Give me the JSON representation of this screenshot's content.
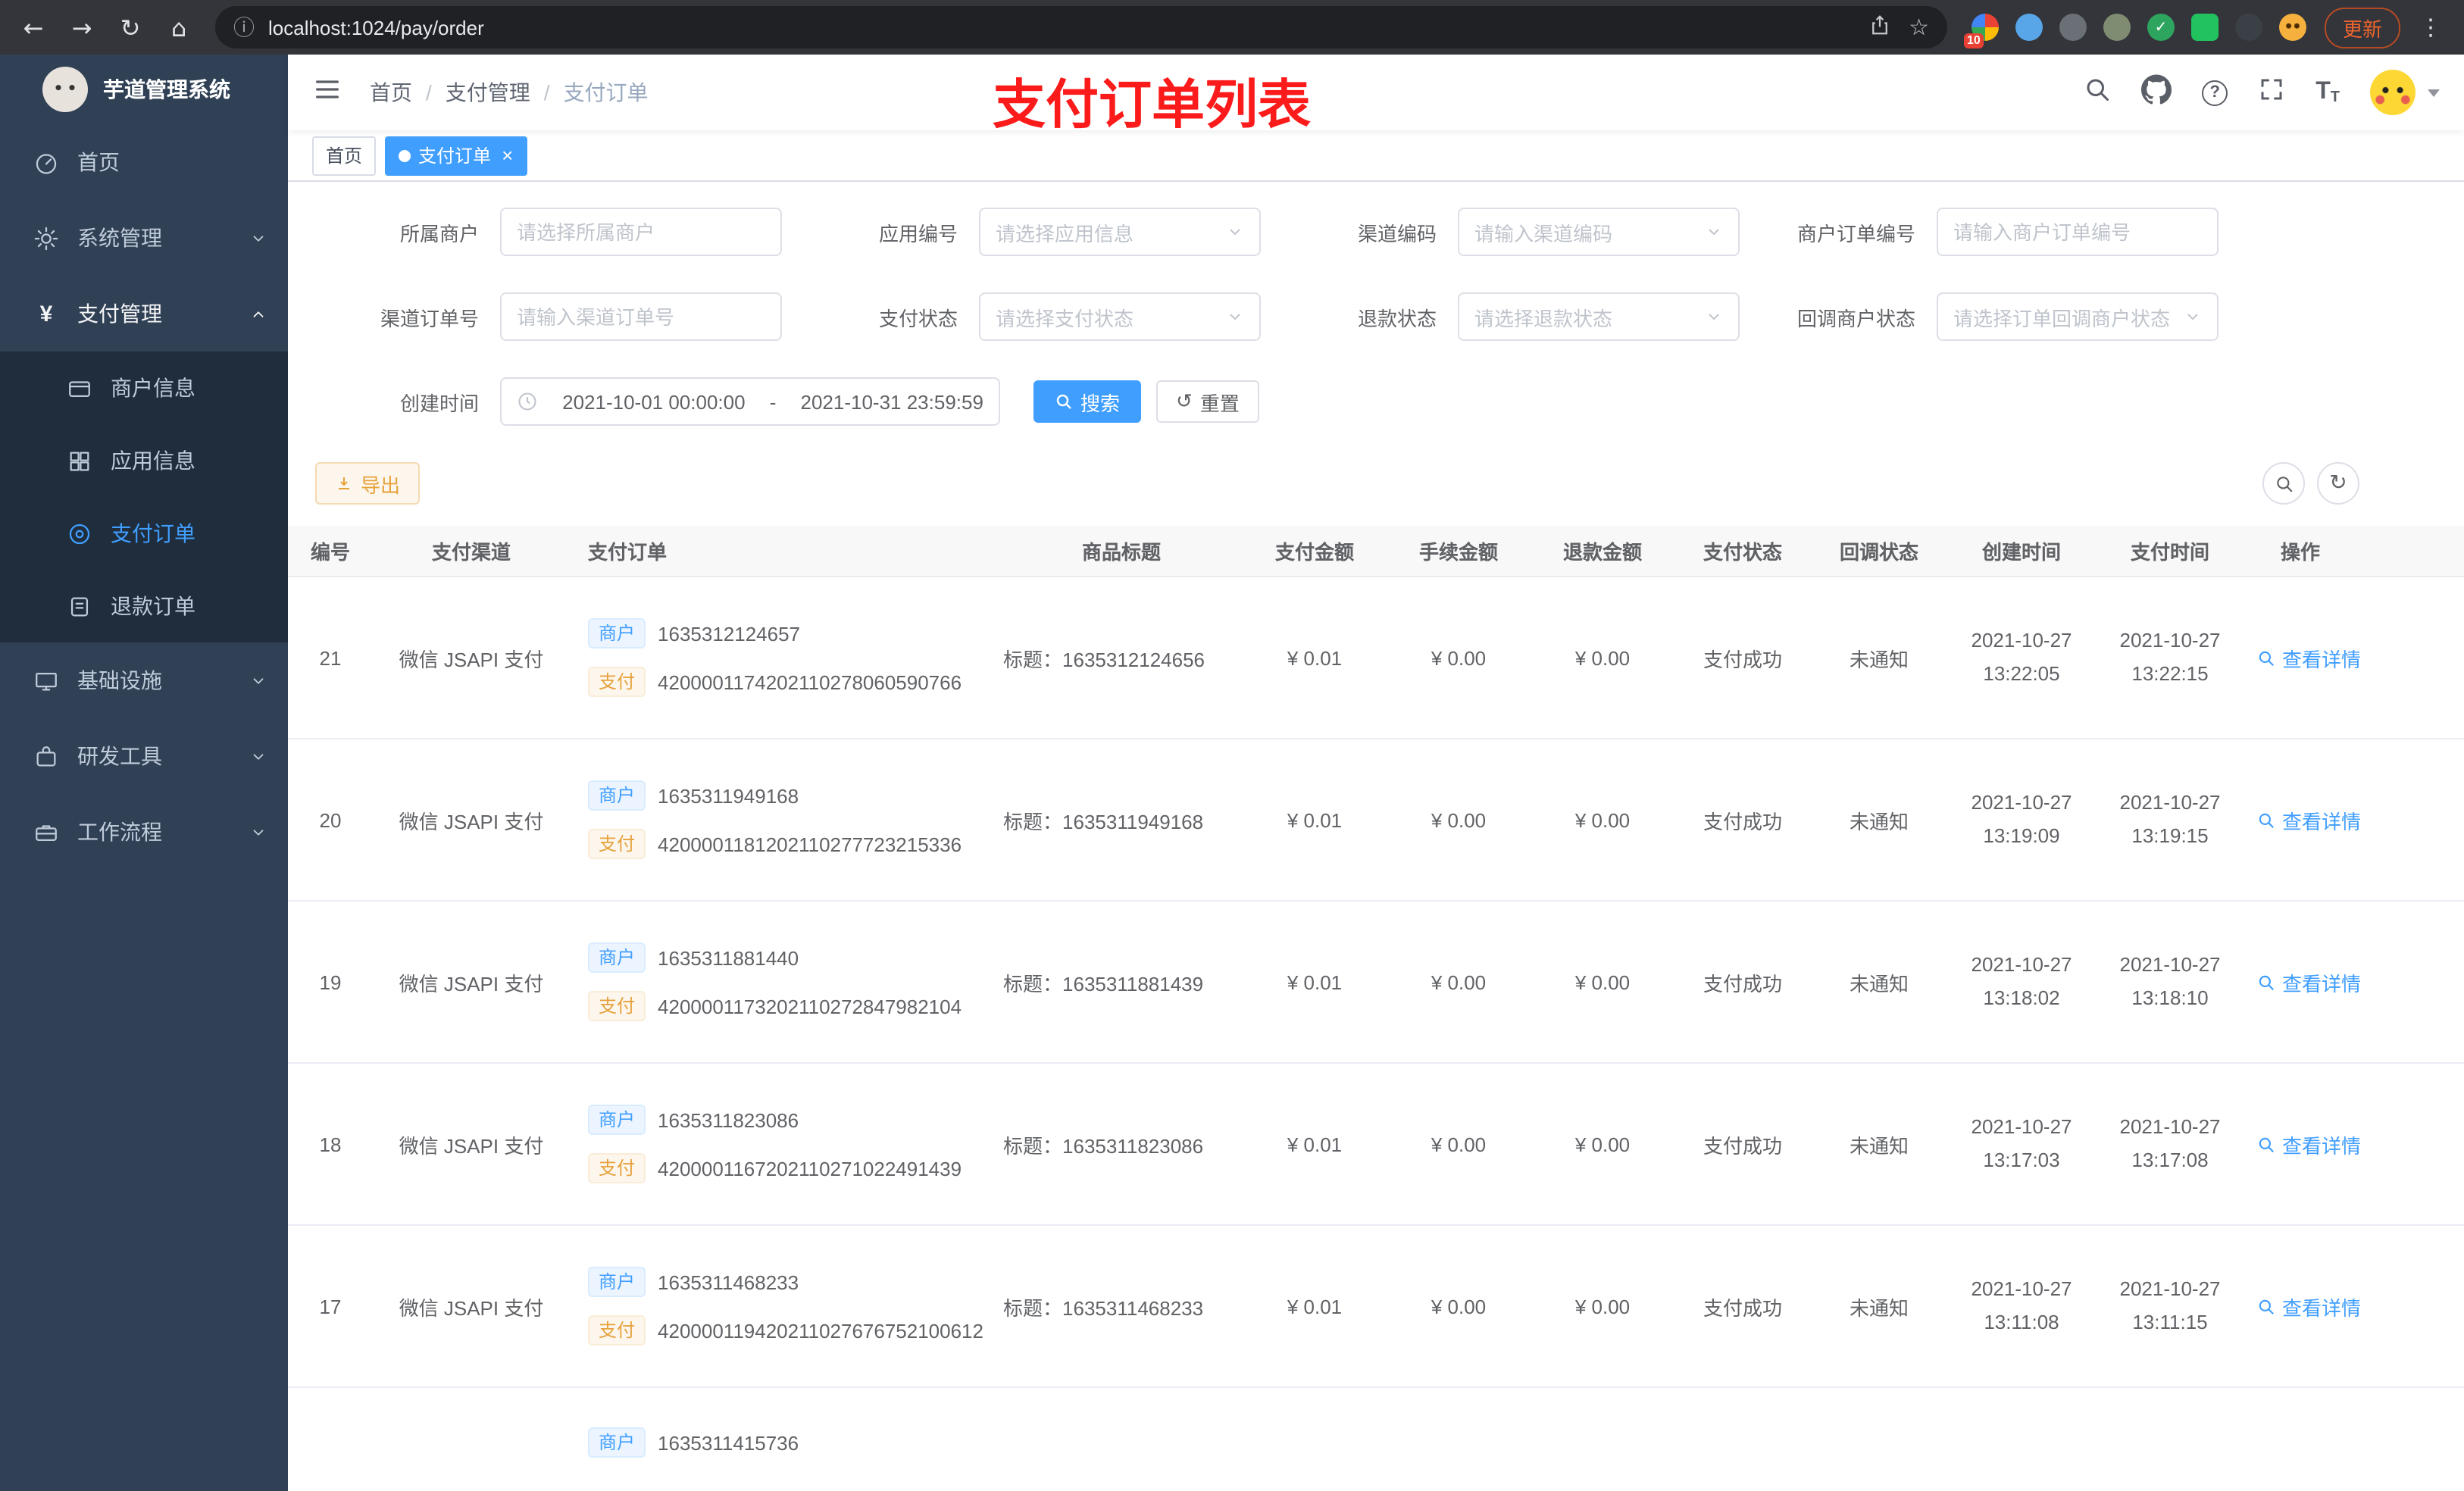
{
  "colors": {
    "accent": "#409eff",
    "warning": "#e6a23c",
    "annotation_red": "#fb1b1b",
    "sidebar_bg": "#304156",
    "submenu_bg": "#1f2d3d",
    "tag_blue_bg": "#ecf5ff",
    "tag_orange_bg": "#fdf6ec"
  },
  "icons": {
    "back": "←",
    "forward": "→",
    "reload": "↻",
    "home": "⌂",
    "info": "ⓘ",
    "star": "☆",
    "more": "⋮",
    "reset": "↺",
    "refresh": "↻",
    "question": "?",
    "close": "×",
    "font": "T",
    "check": "✓"
  },
  "browser": {
    "url": "localhost:1024/pay/order",
    "update_label": "更新",
    "ext_badge": "10"
  },
  "annotation": {
    "text": "支付订单列表"
  },
  "sidebar": {
    "logo_title": "芋道管理系统",
    "items": [
      {
        "label": "首页"
      },
      {
        "label": "系统管理"
      },
      {
        "label": "支付管理"
      },
      {
        "label": "商户信息"
      },
      {
        "label": "应用信息"
      },
      {
        "label": "支付订单"
      },
      {
        "label": "退款订单"
      },
      {
        "label": "基础设施"
      },
      {
        "label": "研发工具"
      },
      {
        "label": "工作流程"
      }
    ]
  },
  "breadcrumb": {
    "separator": "/",
    "items": [
      "首页",
      "支付管理",
      "支付订单"
    ]
  },
  "tabs": {
    "items": [
      {
        "label": "首页"
      },
      {
        "label": "支付订单"
      }
    ]
  },
  "filters": {
    "fields": [
      {
        "label": "所属商户",
        "placeholder": "请选择所属商户"
      },
      {
        "label": "应用编号",
        "placeholder": "请选择应用信息"
      },
      {
        "label": "渠道编码",
        "placeholder": "请输入渠道编码"
      },
      {
        "label": "商户订单编号",
        "placeholder": "请输入商户订单编号"
      },
      {
        "label": "渠道订单号",
        "placeholder": "请输入渠道订单号"
      },
      {
        "label": "支付状态",
        "placeholder": "请选择支付状态"
      },
      {
        "label": "退款状态",
        "placeholder": "请选择退款状态"
      },
      {
        "label": "回调商户状态",
        "placeholder": "请选择订单回调商户状态"
      }
    ],
    "date_label": "创建时间",
    "date_start": "2021-10-01 00:00:00",
    "date_separator": "-",
    "date_end": "2021-10-31 23:59:59",
    "search_label": "搜索",
    "reset_label": "重置"
  },
  "toolbar": {
    "export_label": "导出"
  },
  "table": {
    "headers": [
      "编号",
      "支付渠道",
      "支付订单",
      "商品标题",
      "支付金额",
      "手续金额",
      "退款金额",
      "支付状态",
      "回调状态",
      "创建时间",
      "支付时间",
      "操作"
    ],
    "merchant_tag": "商户",
    "pay_tag": "支付",
    "title_prefix": "标题：",
    "action_label": "查看详情",
    "rows": [
      {
        "id": "21",
        "channel": "微信 JSAPI 支付",
        "merchant_no": "1635312124657",
        "pay_no": "4200001174202110278060590766",
        "title": "1635312124656",
        "amount": "¥ 0.01",
        "fee": "¥ 0.00",
        "refund": "¥ 0.00",
        "status": "支付成功",
        "notify": "未通知",
        "create_date": "2021-10-27",
        "create_time": "13:22:05",
        "pay_date": "2021-10-27",
        "pay_time": "13:22:15"
      },
      {
        "id": "20",
        "channel": "微信 JSAPI 支付",
        "merchant_no": "1635311949168",
        "pay_no": "4200001181202110277723215336",
        "title": "1635311949168",
        "amount": "¥ 0.01",
        "fee": "¥ 0.00",
        "refund": "¥ 0.00",
        "status": "支付成功",
        "notify": "未通知",
        "create_date": "2021-10-27",
        "create_time": "13:19:09",
        "pay_date": "2021-10-27",
        "pay_time": "13:19:15"
      },
      {
        "id": "19",
        "channel": "微信 JSAPI 支付",
        "merchant_no": "1635311881440",
        "pay_no": "4200001173202110272847982104",
        "title": "1635311881439",
        "amount": "¥ 0.01",
        "fee": "¥ 0.00",
        "refund": "¥ 0.00",
        "status": "支付成功",
        "notify": "未通知",
        "create_date": "2021-10-27",
        "create_time": "13:18:02",
        "pay_date": "2021-10-27",
        "pay_time": "13:18:10"
      },
      {
        "id": "18",
        "channel": "微信 JSAPI 支付",
        "merchant_no": "1635311823086",
        "pay_no": "4200001167202110271022491439",
        "title": "1635311823086",
        "amount": "¥ 0.01",
        "fee": "¥ 0.00",
        "refund": "¥ 0.00",
        "status": "支付成功",
        "notify": "未通知",
        "create_date": "2021-10-27",
        "create_time": "13:17:03",
        "pay_date": "2021-10-27",
        "pay_time": "13:17:08"
      },
      {
        "id": "17",
        "channel": "微信 JSAPI 支付",
        "merchant_no": "1635311468233",
        "pay_no": "420000119420211027676752100612",
        "title": "1635311468233",
        "amount": "¥ 0.01",
        "fee": "¥ 0.00",
        "refund": "¥ 0.00",
        "status": "支付成功",
        "notify": "未通知",
        "create_date": "2021-10-27",
        "create_time": "13:11:08",
        "pay_date": "2021-10-27",
        "pay_time": "13:11:15"
      }
    ],
    "partial_row": {
      "merchant_no": "1635311415736"
    }
  }
}
